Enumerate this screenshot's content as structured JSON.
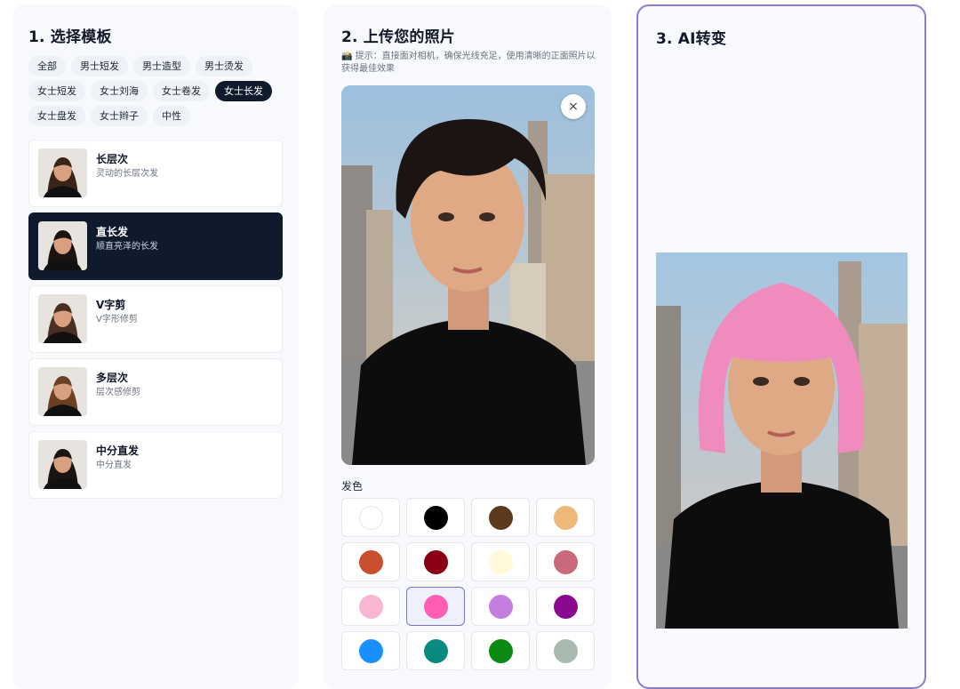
{
  "step1": {
    "title": "1. 选择模板",
    "tags": [
      {
        "label": "全部",
        "active": false
      },
      {
        "label": "男士短发",
        "active": false
      },
      {
        "label": "男士造型",
        "active": false
      },
      {
        "label": "男士烫发",
        "active": false
      },
      {
        "label": "女士短发",
        "active": false
      },
      {
        "label": "女士刘海",
        "active": false
      },
      {
        "label": "女士卷发",
        "active": false
      },
      {
        "label": "女士长发",
        "active": true
      },
      {
        "label": "女士盘发",
        "active": false
      },
      {
        "label": "女士辫子",
        "active": false
      },
      {
        "label": "中性",
        "active": false
      }
    ],
    "templates": [
      {
        "name": "长层次",
        "desc": "灵动的长层次发",
        "active": false,
        "hair": "#3a2418"
      },
      {
        "name": "直长发",
        "desc": "顺直亮泽的长发",
        "active": true,
        "hair": "#1c1410"
      },
      {
        "name": "V字剪",
        "desc": "V字形修剪",
        "active": false,
        "hair": "#4a3022"
      },
      {
        "name": "多层次",
        "desc": "层次感修剪",
        "active": false,
        "hair": "#6b3f22"
      },
      {
        "name": "中分直发",
        "desc": "中分直发",
        "active": false,
        "hair": "#1a1512"
      }
    ]
  },
  "step2": {
    "title": "2. 上传您的照片",
    "hint": "📸 提示：直接面对相机，确保光线充足，使用清晰的正面照片以获得最佳效果",
    "close_label": "×",
    "hair_color_label": "发色",
    "colors": [
      {
        "hex": "#ffffff",
        "selected": false
      },
      {
        "hex": "#000000",
        "selected": false
      },
      {
        "hex": "#5b3a1e",
        "selected": false
      },
      {
        "hex": "#edb87a",
        "selected": false
      },
      {
        "hex": "#c8502f",
        "selected": false
      },
      {
        "hex": "#8b0016",
        "selected": false
      },
      {
        "hex": "#fff8d9",
        "selected": false
      },
      {
        "hex": "#c86a7c",
        "selected": false
      },
      {
        "hex": "#f7b6d2",
        "selected": false
      },
      {
        "hex": "#ff5eb4",
        "selected": true
      },
      {
        "hex": "#c47ee0",
        "selected": false
      },
      {
        "hex": "#8a0a8f",
        "selected": false
      },
      {
        "hex": "#1890ff",
        "selected": false
      },
      {
        "hex": "#0b8a80",
        "selected": false
      },
      {
        "hex": "#0a8a12",
        "selected": false
      },
      {
        "hex": "#a9bbb0",
        "selected": false
      }
    ]
  },
  "step3": {
    "title": "3. AI转变"
  }
}
